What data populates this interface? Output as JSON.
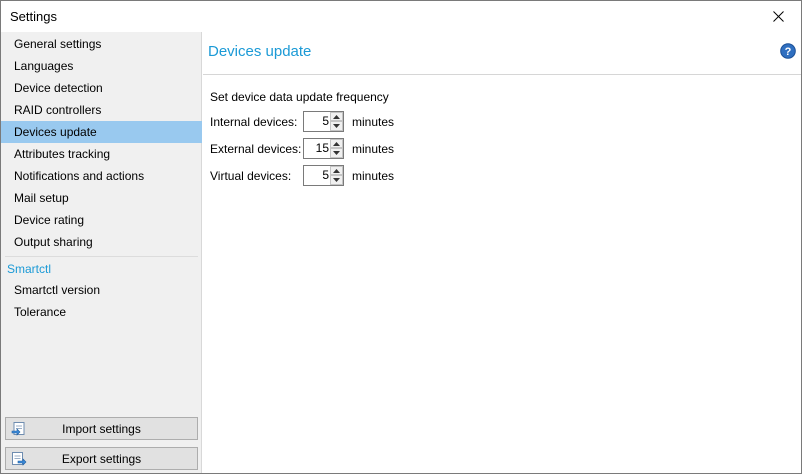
{
  "window": {
    "title": "Settings"
  },
  "sidebar": {
    "items": [
      {
        "label": "General settings"
      },
      {
        "label": "Languages"
      },
      {
        "label": "Device detection"
      },
      {
        "label": "RAID controllers"
      },
      {
        "label": "Devices update",
        "selected": true
      },
      {
        "label": "Attributes tracking"
      },
      {
        "label": "Notifications and actions"
      },
      {
        "label": "Mail setup"
      },
      {
        "label": "Device rating"
      },
      {
        "label": "Output sharing"
      }
    ],
    "group2": {
      "header": "Smartctl",
      "items": [
        {
          "label": "Smartctl version"
        },
        {
          "label": "Tolerance"
        }
      ]
    },
    "buttons": {
      "import_label": "Import settings",
      "export_label": "Export settings"
    }
  },
  "content": {
    "title": "Devices update",
    "section_label": "Set device data update frequency",
    "rows": [
      {
        "label": "Internal devices:",
        "value": "5",
        "unit": "minutes"
      },
      {
        "label": "External devices:",
        "value": "15",
        "unit": "minutes"
      },
      {
        "label": "Virtual devices:",
        "value": "5",
        "unit": "minutes"
      }
    ]
  },
  "colors": {
    "accent": "#1b9ad6",
    "selection": "#99c9ef",
    "sidebar_bg": "#f0f0f0"
  },
  "icons": {
    "close": "close-icon",
    "help": "help-icon",
    "import": "import-icon",
    "export": "export-icon"
  }
}
